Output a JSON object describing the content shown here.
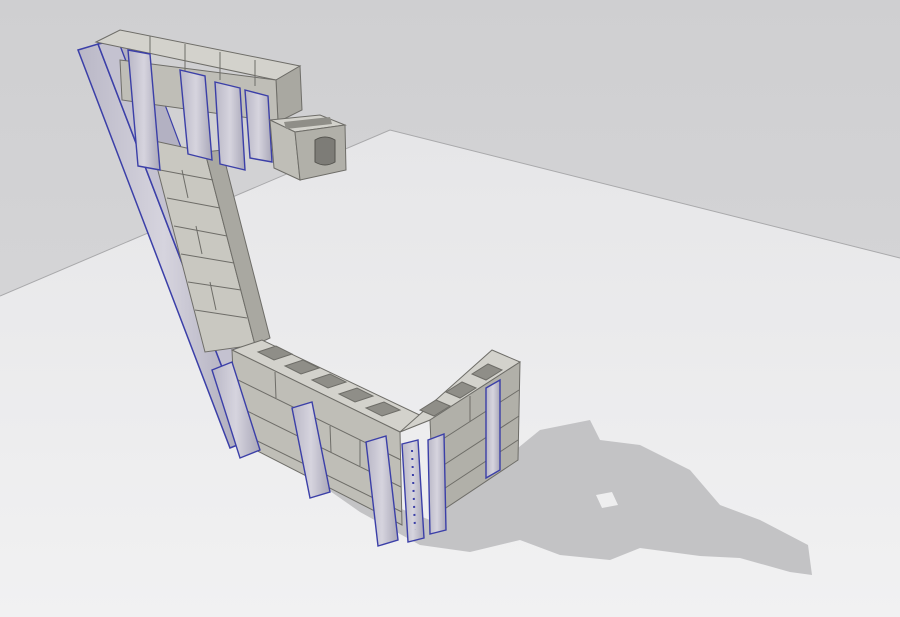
{
  "scene": {
    "kind": "3d-render",
    "subject": "masonry-block-wall-assembly",
    "colors": {
      "back_wall": "#d6d6d8",
      "floor": "#eeeeef",
      "floor_shadow": "#bdbdbf",
      "block_top": "#d3d2cc",
      "block_front": "#bfbeb7",
      "block_side": "#a9a8a1",
      "mortar_line": "#6e6d68",
      "panel_face": "#c9c7d3",
      "panel_edge": "#3b3fa8"
    }
  }
}
